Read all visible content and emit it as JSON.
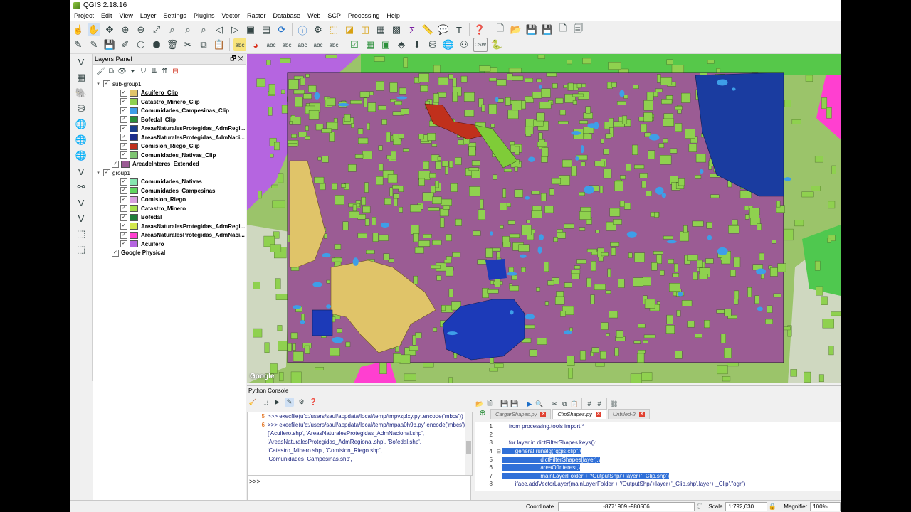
{
  "window": {
    "title": "QGIS 2.18.16"
  },
  "menu": [
    "Project",
    "Edit",
    "View",
    "Layer",
    "Settings",
    "Plugins",
    "Vector",
    "Raster",
    "Database",
    "Web",
    "SCP",
    "Processing",
    "Help"
  ],
  "layers_panel": {
    "title": "Layers Panel",
    "tree": [
      {
        "kind": "group",
        "name": "sub-group1",
        "expanded": true,
        "children": [
          {
            "name": "Acuifero_Clip",
            "color": "#e0c469",
            "underline": true
          },
          {
            "name": "Catastro_Minero_Clip",
            "color": "#8fd14f"
          },
          {
            "name": "Comunidades_Campesinas_Clip",
            "color": "#3e9ee8"
          },
          {
            "name": "Bofedal_Clip",
            "color": "#2a8f3a"
          },
          {
            "name": "AreasNaturalesProtegidas_AdmRegi...",
            "color": "#1a3d8a"
          },
          {
            "name": "AreasNaturalesProtegidas_AdmNaci...",
            "color": "#1c2e8c"
          },
          {
            "name": "Comision_Riego_Clip",
            "color": "#c0301c"
          },
          {
            "name": "Comunidades_Nativas_Clip",
            "color": "#7fc472"
          }
        ]
      },
      {
        "kind": "layer",
        "name": "AreadeInteres_Extended",
        "color": "#9b5c94"
      },
      {
        "kind": "group",
        "name": "group1",
        "expanded": true,
        "children": [
          {
            "name": "Comunidades_Nativas",
            "color": "#86e6b0"
          },
          {
            "name": "Comunidades_Campesinas",
            "color": "#5fd65f"
          },
          {
            "name": "Comision_Riego",
            "color": "#d8a0e0"
          },
          {
            "name": "Catastro_Minero",
            "color": "#a4e04c"
          },
          {
            "name": "Bofedal",
            "color": "#1e7d3a"
          },
          {
            "name": "AreasNaturalesProtegidas_AdmRegi...",
            "color": "#d4e84c"
          },
          {
            "name": "AreasNaturalesProtegidas_AdmNaci...",
            "color": "#ff3fd0"
          },
          {
            "name": "Acuifero",
            "color": "#b565e0"
          }
        ]
      },
      {
        "kind": "layer",
        "name": "Google Physical",
        "color": null
      }
    ]
  },
  "map": {
    "attribution": "Google"
  },
  "python_console": {
    "title": "Python Console",
    "output": [
      {
        "n": "5",
        "text": ">>> execfile(u'c:/users/saul/appdata/local/temp/tmpvzplxy.py'.encode('mbcs'))"
      },
      {
        "n": "6",
        "text": ">>> execfile(u'c:/users/saul/appdata/local/temp/tmpaa0h9b.py'.encode('mbcs'))"
      },
      {
        "n": "",
        "text": "['Acuifero.shp', 'AreasNaturalesProtegidas_AdmNacional.shp', 'AreasNaturalesProtegidas_AdmRegional.shp', 'Bofedal.shp', 'Catastro_Minero.shp', 'Comision_Riego.shp', 'Comunidades_Campesinas.shp',"
      }
    ],
    "prompt": ">>>",
    "editor_tabs": [
      {
        "label": "CargarShapes.py",
        "active": false
      },
      {
        "label": "ClipShapes.py",
        "active": true
      },
      {
        "label": "Untitled-2",
        "active": false
      }
    ],
    "code": [
      {
        "n": "1",
        "text": "    from processing.tools import *"
      },
      {
        "n": "2",
        "text": ""
      },
      {
        "n": "3",
        "text": "    for layer in dictFilterShapes.keys():"
      },
      {
        "n": "4",
        "text": "        general.runalg(\"qgis:clip\",\\"
      },
      {
        "n": "5",
        "text": "                        dictFilterShapes[layer],\\"
      },
      {
        "n": "6",
        "text": "                        areaOfInterest,\\"
      },
      {
        "n": "7",
        "text": "                        mainLayerFolder + '/OutputShp/'+layer+'_Clip.shp')"
      },
      {
        "n": "8",
        "text": "        iface.addVectorLayer(mainLayerFolder + '/OutputShp/'+layer+'_Clip.shp',layer+'_Clip',\"ogr\")"
      }
    ]
  },
  "statusbar": {
    "coordinate_label": "Coordinate",
    "coordinate_value": "-8771909,-980506",
    "scale_label": "Scale",
    "scale_value": "1:792,630",
    "magnifier_label": "Magnifier",
    "magnifier_value": "100%"
  },
  "colors": {
    "aoi_fill": "#9b5c94",
    "catastro": "#8fd14f",
    "acuifero": "#e0c469",
    "anp": "#1a3ca0",
    "comision": "#c0301c",
    "acuifero_group": "#b565e0",
    "anp_nac": "#ff3fd0"
  }
}
